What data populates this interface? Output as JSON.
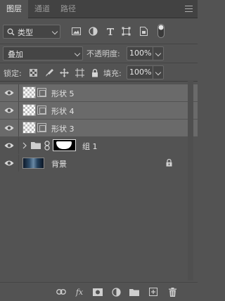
{
  "tabs": [
    {
      "label": "图层",
      "active": true
    },
    {
      "label": "通道",
      "active": false
    },
    {
      "label": "路径",
      "active": false
    }
  ],
  "filter": {
    "kind_label": "类型",
    "icons": [
      "image-filter-icon",
      "adjustment-filter-icon",
      "type-filter-icon",
      "shape-filter-icon",
      "smart-object-filter-icon",
      "filter-toggle-icon"
    ]
  },
  "blend": {
    "mode": "叠加",
    "opacity_label": "不透明度:",
    "opacity_value": "100%"
  },
  "lock": {
    "label": "锁定:",
    "fill_label": "填充:",
    "fill_value": "100%"
  },
  "layers": [
    {
      "name": "形状 5",
      "type": "shape",
      "selected": true
    },
    {
      "name": "形状 4",
      "type": "shape",
      "selected": true
    },
    {
      "name": "形状 3",
      "type": "shape",
      "selected": true
    },
    {
      "name": "组 1",
      "type": "group",
      "selected": false
    },
    {
      "name": "背景",
      "type": "background",
      "selected": false,
      "locked": true
    }
  ],
  "colors": {
    "panel": "#535353",
    "selected_row": "#6a6a6a",
    "tabbar": "#424242"
  }
}
